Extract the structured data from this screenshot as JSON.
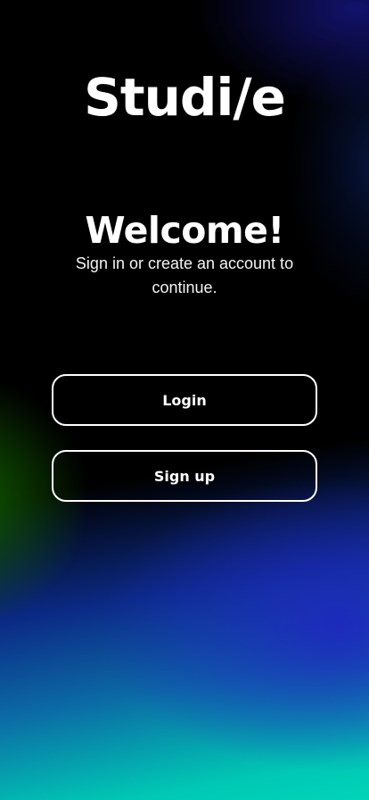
{
  "app": {
    "logo_text": "Studi/e"
  },
  "welcome": {
    "title": "Welcome!",
    "subtitle": "Sign in or create an account to continue."
  },
  "actions": {
    "login_label": "Login",
    "signup_label": "Sign up"
  },
  "colors": {
    "text": "#ffffff",
    "background_top": "#000000",
    "gradient_blue": "#1e28be",
    "gradient_teal": "#00d4b8",
    "gradient_green": "#146e00"
  }
}
